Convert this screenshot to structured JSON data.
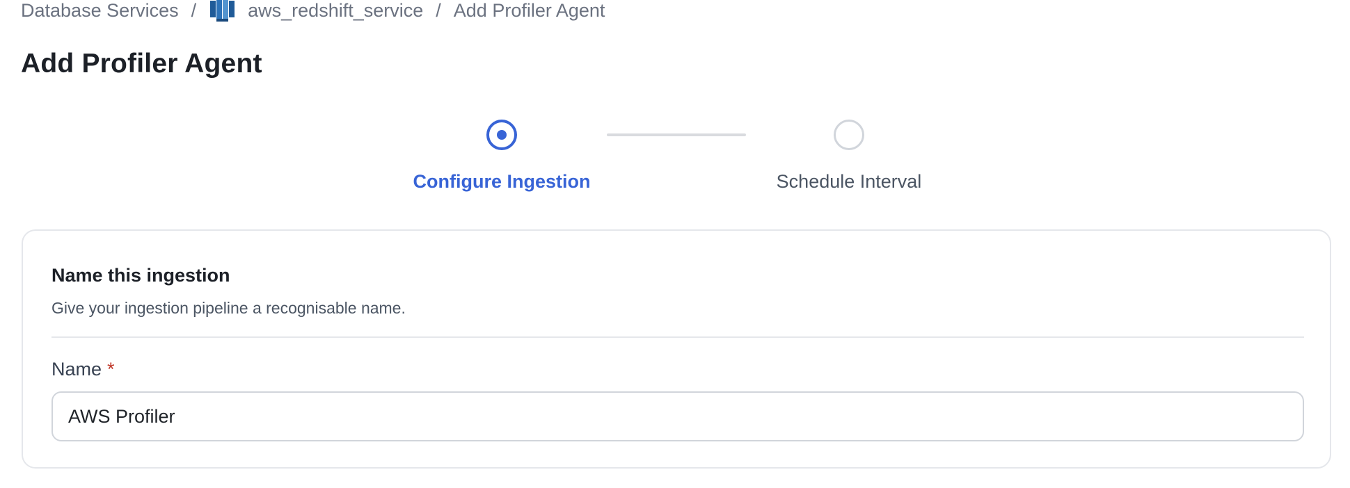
{
  "breadcrumb": {
    "root": "Database Services",
    "separator": "/",
    "service": "aws_redshift_service",
    "service_icon": "redshift-icon",
    "current": "Add Profiler Agent"
  },
  "page": {
    "title": "Add Profiler Agent"
  },
  "stepper": {
    "steps": [
      {
        "label": "Configure Ingestion",
        "state": "active"
      },
      {
        "label": "Schedule Interval",
        "state": "inactive"
      }
    ]
  },
  "form": {
    "section_title": "Name this ingestion",
    "section_description": "Give your ingestion pipeline a recognisable name.",
    "name_label": "Name",
    "required_marker": "*",
    "name_value": "AWS Profiler"
  },
  "colors": {
    "accent": "#3864d6",
    "required": "#c0392b",
    "muted_text": "#6b7280",
    "border": "#e5e7eb"
  }
}
